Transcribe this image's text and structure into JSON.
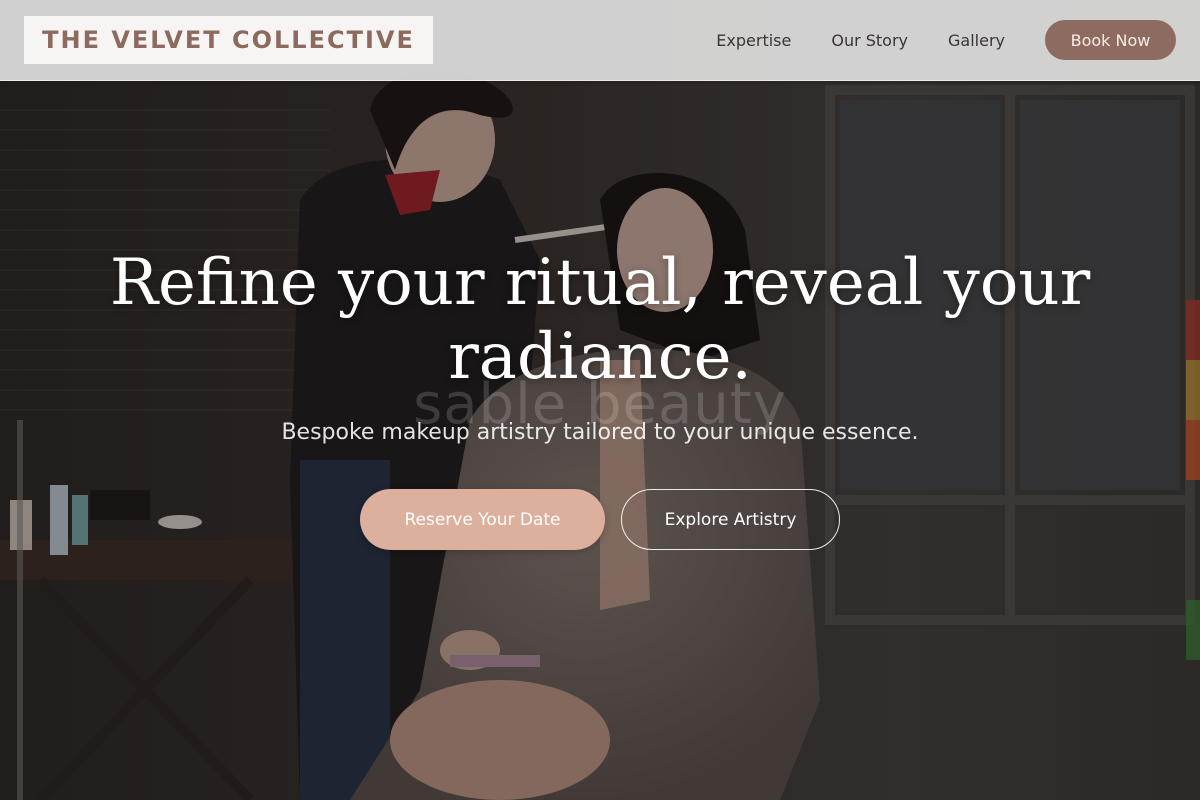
{
  "brand": {
    "name": "THE VELVET COLLECTIVE"
  },
  "nav": {
    "links": [
      {
        "label": "Expertise"
      },
      {
        "label": "Our Story"
      },
      {
        "label": "Gallery"
      }
    ],
    "cta_label": "Book Now"
  },
  "hero": {
    "title": "Refine your ritual, reveal your radiance.",
    "watermark": "sable beauty",
    "subtitle": "Bespoke makeup artistry tailored to your unique essence.",
    "primary_cta": "Reserve Your Date",
    "secondary_cta": "Explore Artistry",
    "background_image": "makeup-artist-applying-makeup-photo"
  },
  "colors": {
    "brand_text": "#8c6a5e",
    "nav_cta_bg": "#8d6b60",
    "primary_cta_bg": "#dcb09d",
    "header_bg": "#dedede"
  }
}
